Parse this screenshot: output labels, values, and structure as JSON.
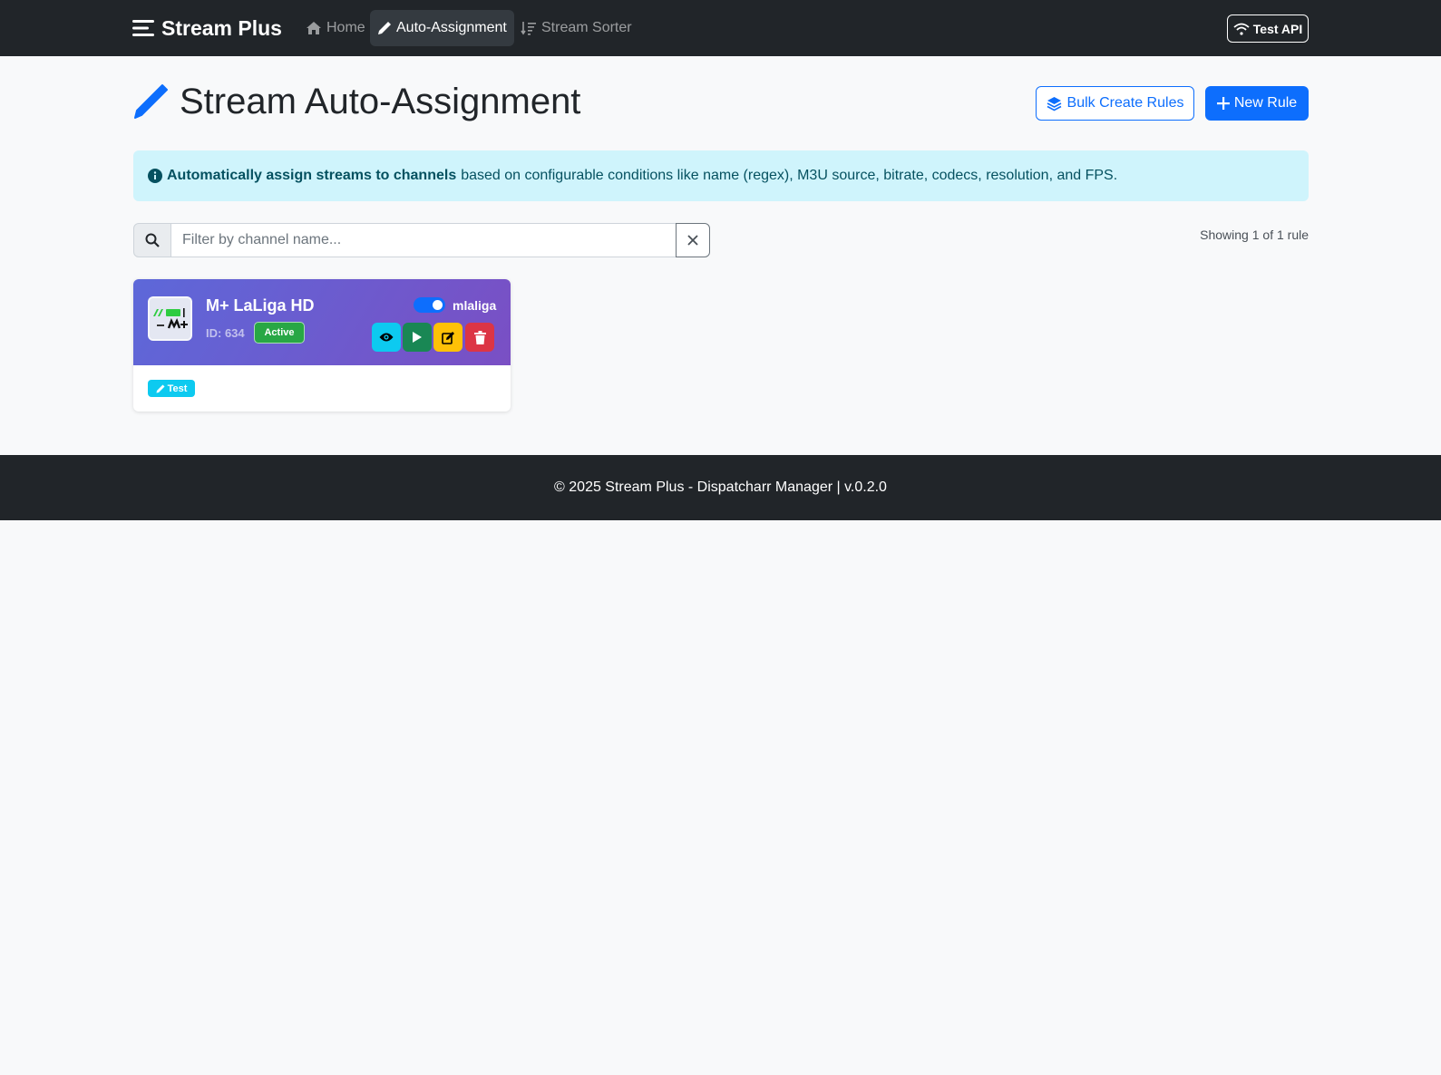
{
  "navbar": {
    "brand": "Stream Plus",
    "items": [
      {
        "label": "Home",
        "icon": "home-icon"
      },
      {
        "label": "Auto-Assignment",
        "icon": "pencil-icon",
        "active": true
      },
      {
        "label": "Stream Sorter",
        "icon": "sort-icon"
      }
    ],
    "test_api_label": "Test API"
  },
  "header": {
    "title": "Stream Auto-Assignment",
    "bulk_create_label": "Bulk Create Rules",
    "new_rule_label": "New Rule"
  },
  "alert": {
    "bold_text": "Automatically assign streams to channels",
    "text": "based on configurable conditions like name (regex), M3U source, bitrate, codecs, resolution, and FPS."
  },
  "filter": {
    "placeholder": "Filter by channel name...",
    "value": "",
    "showing_text": "Showing 1 of 1 rule"
  },
  "rules": [
    {
      "channel_name": "M+ LaLiga HD",
      "channel_id": "ID: 634",
      "status": "Active",
      "enabled": true,
      "toggle_label": "mlaliga",
      "test_label": "Test"
    }
  ],
  "footer": {
    "text": "© 2025 Stream Plus - Dispatcharr Manager | v.0.2.0"
  },
  "colors": {
    "navbar": "#212529",
    "primary": "#0d6efd",
    "info_bg": "#cff4fc",
    "success": "#28a745",
    "view": "#0dcaf0",
    "run": "#198754",
    "edit": "#ffc107",
    "delete": "#dc3545"
  }
}
